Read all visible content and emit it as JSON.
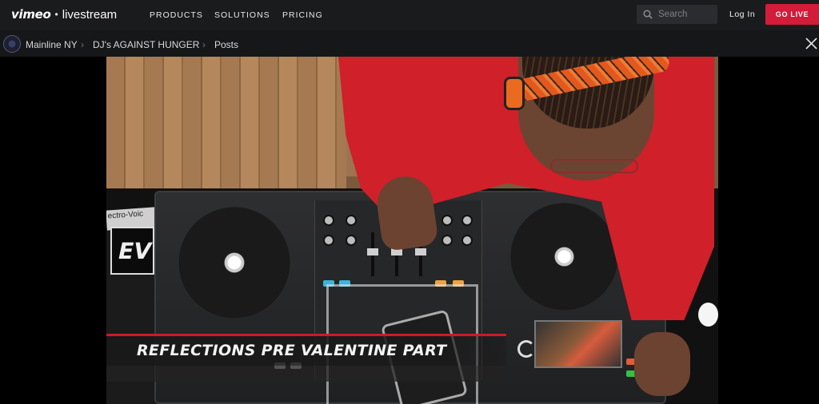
{
  "nav": {
    "logo_brand": "vimeo",
    "logo_separator": "•",
    "logo_product": "livestream",
    "links": [
      "PRODUCTS",
      "SOLUTIONS",
      "PRICING"
    ],
    "search_placeholder": "Search",
    "login_label": "Log In",
    "golive_label": "GO LIVE"
  },
  "breadcrumb": {
    "items": [
      "Mainline NY",
      "DJ's AGAINST HUNGER",
      "Posts"
    ],
    "separator": "›"
  },
  "player": {
    "banner_title": "REFLECTIONS PRE VALENTINE  PART",
    "sign_text": "EV",
    "strip_text": "ectro-Voic"
  },
  "colors": {
    "nav_bg": "#1a1b1d",
    "accent": "#d31b3a",
    "banner_rule": "#cc1b26"
  },
  "icons": {
    "search": "search-icon",
    "close": "close-icon",
    "separator": "chevron-right-icon"
  }
}
